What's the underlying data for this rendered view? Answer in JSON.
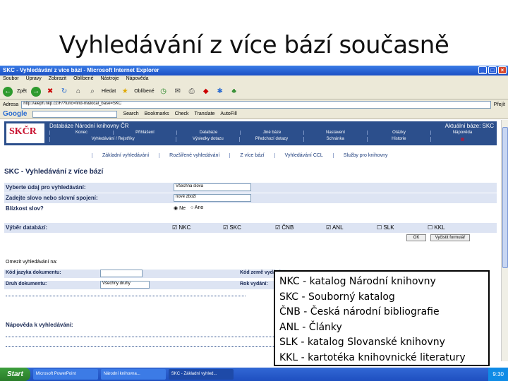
{
  "slide": {
    "title": "Vyhledávání z více bází současně"
  },
  "browser": {
    "window_title": "SKC - Vyhledávání z více bází - Microsoft Internet Explorer",
    "menu": [
      "Soubor",
      "Úpravy",
      "Zobrazit",
      "Oblíbené",
      "Nástroje",
      "Nápověda"
    ],
    "toolbar": {
      "back": "Zpět",
      "search": "Hledat",
      "favorites": "Oblíbené"
    },
    "address_label": "Adresa",
    "address_value": "http://aleph.nkp.cz/F/?func=find-m&local_base=SKC",
    "go_label": "Přejít",
    "google_label": "Google",
    "google_items": [
      "Search",
      "Bookmarks",
      "Check",
      "Translate",
      "AutoFill"
    ]
  },
  "site": {
    "name": "Databáze Národní knihovny ČR",
    "logo": "SKČR",
    "current_base": "Aktuální báze: SKC",
    "nav_top": [
      "Konec",
      "Přihlášení",
      "Databáze",
      "Jiné báze",
      "Nastavení",
      "Otázky",
      "Nápověda"
    ],
    "nav_bottom": [
      "Vyhledávání / Rejstříky",
      "Výsledky dotazu",
      "Předchozí dotazy",
      "Schránka",
      "Historie"
    ],
    "tabs": [
      "Základní vyhledávání",
      "Rozšířené vyhledávání",
      "Z více bází",
      "Vyhledávání CCL",
      "Služby pro knihovny"
    ]
  },
  "form": {
    "heading": "SKC - Vyhledávání z více bází",
    "field_label": "Vyberte údaj pro vyhledávání:",
    "field_value": "Všechna slova",
    "query_label": "Zadejte slovo nebo slovní spojení:",
    "query_value": "nové zboží",
    "proximity_label": "Blízkost slov?",
    "proximity_no": "Ne",
    "proximity_yes": "Ano",
    "db_label": "Výběr databází:",
    "databases": [
      "NKC",
      "SKC",
      "ČNB",
      "ANL",
      "SLK",
      "KKL"
    ],
    "ok_label": "OK",
    "clear_label": "Vyčistit formulář",
    "limit_heading": "Omezit vyhledávání na:",
    "lang_label": "Kód jazyka dokumentu:",
    "country_label": "Kód země vydání:",
    "doctype_label": "Druh dokumentu:",
    "doctype_value": "Všechny druhy",
    "year_label": "Rok vydání:",
    "help_heading": "Nápověda k vyhledávání:"
  },
  "overlay": {
    "lines": [
      "NKC - katalog Národní knihovny",
      "SKC - Souborný katalog",
      "ČNB - Česká národní bibliografie",
      "ANL - Články",
      "SLK - katalog Slovanské knihovny",
      "KKL - kartotéka knihovnické literatury"
    ]
  },
  "taskbar": {
    "start": "Start",
    "items": [
      "Microsoft PowerPoint",
      "Národní knihovna...",
      "SKC - Základní vyhled..."
    ],
    "clock": "9:30"
  }
}
